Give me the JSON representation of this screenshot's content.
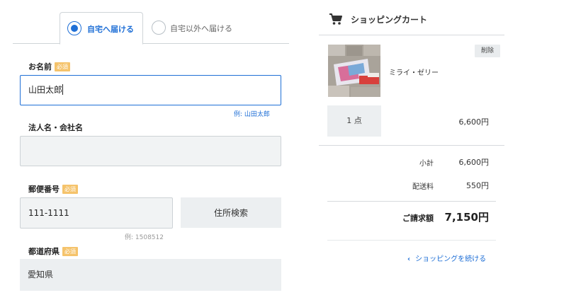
{
  "delivery_tabs": {
    "home_label": "自宅へ届ける",
    "other_label": "自宅以外へ届ける",
    "selected": "home"
  },
  "form": {
    "required_badge": "必須",
    "name": {
      "label": "お名前",
      "value": "山田太郎",
      "example": "例: 山田太郎"
    },
    "company": {
      "label": "法人名・会社名",
      "value": ""
    },
    "postal": {
      "label": "郵便番号",
      "value": "111-1111",
      "example": "例: 1508512",
      "search_button": "住所検索"
    },
    "prefecture": {
      "label": "都道府県",
      "value": "愛知県"
    }
  },
  "cart": {
    "title": "ショッピングカート",
    "icon": "cart-icon",
    "item": {
      "name": "ミライ・ゼリー",
      "delete_label": "削除",
      "quantity": "1 点",
      "price": "6,600円"
    },
    "summary": {
      "subtotal_label": "小計",
      "subtotal": "6,600円",
      "shipping_label": "配送料",
      "shipping": "550円",
      "total_label": "ご請求額",
      "total": "7,150円"
    },
    "continue_label": "ショッピングを続ける"
  },
  "colors": {
    "accent": "#1f6fd6",
    "required_badge": "#f5c36b",
    "field_bg": "#f1f3f4",
    "button_bg": "#eceff1"
  }
}
